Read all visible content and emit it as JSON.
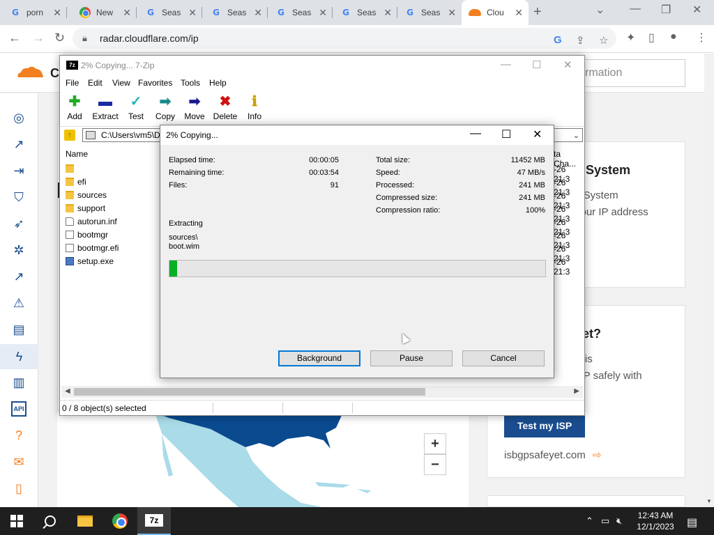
{
  "browser": {
    "tabs": [
      {
        "title": "porn",
        "icon": "google-icon"
      },
      {
        "title": "New",
        "icon": "chrome-icon"
      },
      {
        "title": "Seas",
        "icon": "google-icon"
      },
      {
        "title": "Seas",
        "icon": "google-icon"
      },
      {
        "title": "Seas",
        "icon": "google-icon"
      },
      {
        "title": "Seas",
        "icon": "google-icon"
      },
      {
        "title": "Seas",
        "icon": "google-icon"
      },
      {
        "title": "Clou",
        "icon": "cloudflare-icon",
        "active": true
      }
    ],
    "url": "radar.cloudflare.com/ip"
  },
  "webpage": {
    "brand_letter": "C",
    "search_placeholder": "rmation",
    "card1": {
      "heading": "s System",
      "line1": "s System",
      "line2": "your IP address"
    },
    "card2": {
      "heading": "yet?",
      "line1": "P is",
      "line2": "GP safely with",
      "button": "Test my ISP",
      "link": "isbgpsafeyet.com"
    },
    "zoom_in": "+",
    "zoom_out": "−"
  },
  "zip_window": {
    "title": "2% Copying... 7-Zip",
    "menu": [
      "File",
      "Edit",
      "View",
      "Favorites",
      "Tools",
      "Help"
    ],
    "toolbar": [
      {
        "label": "Add",
        "icon": "plus-icon"
      },
      {
        "label": "Extract",
        "icon": "minus-icon"
      },
      {
        "label": "Test",
        "icon": "check-icon"
      },
      {
        "label": "Copy",
        "icon": "copy-arrow-icon"
      },
      {
        "label": "Move",
        "icon": "move-arrow-icon"
      },
      {
        "label": "Delete",
        "icon": "delete-x-icon"
      },
      {
        "label": "Info",
        "icon": "info-icon"
      }
    ],
    "path": "C:\\Users\\vm5\\D",
    "column_name": "Name",
    "column_date": "ta Cha...",
    "files": [
      {
        "name": "",
        "type": "folder",
        "date": "-26 21:3"
      },
      {
        "name": "efi",
        "type": "folder",
        "date": "-26 21:3"
      },
      {
        "name": "sources",
        "type": "folder",
        "date": "-26 21:3"
      },
      {
        "name": "support",
        "type": "folder",
        "date": "-26 21:3"
      },
      {
        "name": "autorun.inf",
        "type": "inf",
        "date": "-26 21:3"
      },
      {
        "name": "bootmgr",
        "type": "file",
        "date": "-26 21:3"
      },
      {
        "name": "bootmgr.efi",
        "type": "file",
        "date": "-26 21:3"
      },
      {
        "name": "setup.exe",
        "type": "exe",
        "date": "-26 21:3"
      }
    ],
    "status": "0 / 8 object(s) selected"
  },
  "progress_dialog": {
    "title": "2% Copying...",
    "left_stats": [
      {
        "label": "Elapsed time:",
        "value": "00:00:05"
      },
      {
        "label": "Remaining time:",
        "value": "00:03:54"
      },
      {
        "label": "Files:",
        "value": "91"
      }
    ],
    "right_stats": [
      {
        "label": "Total size:",
        "value": "11452 MB"
      },
      {
        "label": "Speed:",
        "value": "47 MB/s"
      },
      {
        "label": "Processed:",
        "value": "241 MB"
      },
      {
        "label": "Compressed size:",
        "value": "241 MB"
      },
      {
        "label": "Compression ratio:",
        "value": "100%"
      }
    ],
    "operation": "Extracting",
    "current_path": "sources\\",
    "current_file": "boot.wim",
    "progress_percent": 2,
    "buttons": {
      "background": "Background",
      "pause": "Pause",
      "cancel": "Cancel"
    }
  },
  "taskbar": {
    "time": "12:43 AM",
    "date": "12/1/2023"
  },
  "colors": {
    "cloudflare_orange": "#f38020",
    "progress_green": "#06b025",
    "link_blue": "#1a4d8f"
  }
}
